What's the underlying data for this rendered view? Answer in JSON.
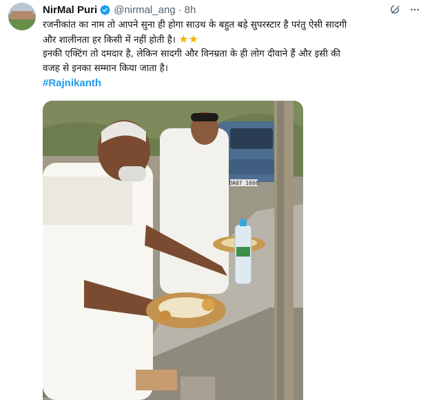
{
  "author": {
    "name": "NirMal Puri",
    "handle": "@nirmal_ang",
    "separator": "·",
    "time": "8h",
    "avatar_icon": "avatar-photo",
    "verified_icon": "verified-badge-icon"
  },
  "actions": {
    "grok_icon": "grok-icon",
    "more_icon": "more-icon"
  },
  "post": {
    "line1": "रजनीकांत का नाम तो आपने सुना ही होगा साउथ के बहुत बड़े सुपरस्टार है परंतु ऐसी सादगी",
    "line2": "और शालीनता हर किसी में नहीं होती है।",
    "stars": "★★",
    "line3": "इनकी एक्टिंग तो दमदार है, लेकिन सादगी और विनम्रता के ही लोग दीवाने हैं और इसी की",
    "line4": "वजह से इनका सम्मान किया जाता है।",
    "hashtag": "#Rajnikanth"
  },
  "media": {
    "license_plate": "OA07 1666"
  },
  "colors": {
    "accent": "#1d9bf0",
    "text": "#0f1419",
    "muted": "#536471",
    "star": "#f4b400"
  }
}
